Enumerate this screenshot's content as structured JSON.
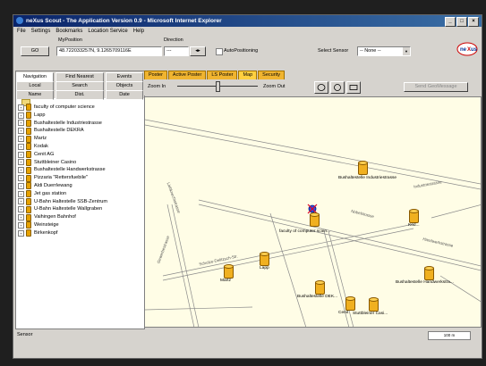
{
  "window": {
    "title": "neXus Scout - The Application Version 0.9 - Microsoft Internet Explorer",
    "min_label": "_",
    "max_label": "□",
    "close_label": "×"
  },
  "menu": [
    "File",
    "Settings",
    "Bookmarks",
    "Location Service",
    "Help"
  ],
  "toolbar": {
    "my_position_label": "MyPosition",
    "go_label": "GO",
    "position_value": "48.722033257N, 9.1265709116E",
    "direction_label": "Direction",
    "direction_value": "---",
    "auto_positioning_label": "AutoPositioning",
    "select_sensor_label": "Select Sensor",
    "sensor_value": "-- None --",
    "logo_text": "ne us"
  },
  "left_panel": {
    "tabs": [
      "Navigation",
      "Find Nearest",
      "Events"
    ],
    "subtabs": [
      "Local",
      "Search",
      "Objects"
    ],
    "columns": [
      "Name",
      "Dist.",
      "Date"
    ],
    "items": [
      "faculty of computer science",
      "Lapp",
      "Bushaltestelle Industriestrasse",
      "Bushaltestelle DEKRA",
      "Martz",
      "Kodak",
      "Cenit AG",
      "Stuttbleiner Casino",
      "Bushaltestelle Handwerkstrasse",
      "Pizzaria \"Rettersfuebile\"",
      "Aldi Duerrlewang",
      "Jet gas station",
      "U-Bahn Haltestelle SSB-Zentrum",
      "U-Bahn Haltestelle Wallgraben",
      "Vaihingen Bahnhof",
      "Weinsteige",
      "Birkenkopf"
    ]
  },
  "map_panel": {
    "tabs": [
      "Poster",
      "Active Poster",
      "LS Poster",
      "Map",
      "Security"
    ],
    "active_tab": "Map",
    "zoom_in_label": "Zoom In",
    "zoom_out_label": "Zoom Out",
    "send_message_label": "Send GeoMessage",
    "pois": [
      {
        "label": "Bushaltestelle Industriestrasse"
      },
      {
        "label": "faculty of computer scien..."
      },
      {
        "label": "Kod..."
      },
      {
        "label": "Lapp"
      },
      {
        "label": "Martz"
      },
      {
        "label": "Bushaltestelle DEK..."
      },
      {
        "label": "Bushaltestelle Handwerkstra..."
      },
      {
        "label": "Cenit"
      },
      {
        "label": "Stuttbleiner Casi..."
      }
    ],
    "streets": [
      "Industriestrasse",
      "Nobelstrasse",
      "Handwerkstrasse",
      "Schulze-Delitzsch-Str.",
      "Gewerbestrasse",
      "Liebknechtstrasse"
    ]
  },
  "status": {
    "sensor_label": "Sensor",
    "scale_label": "100 m"
  }
}
